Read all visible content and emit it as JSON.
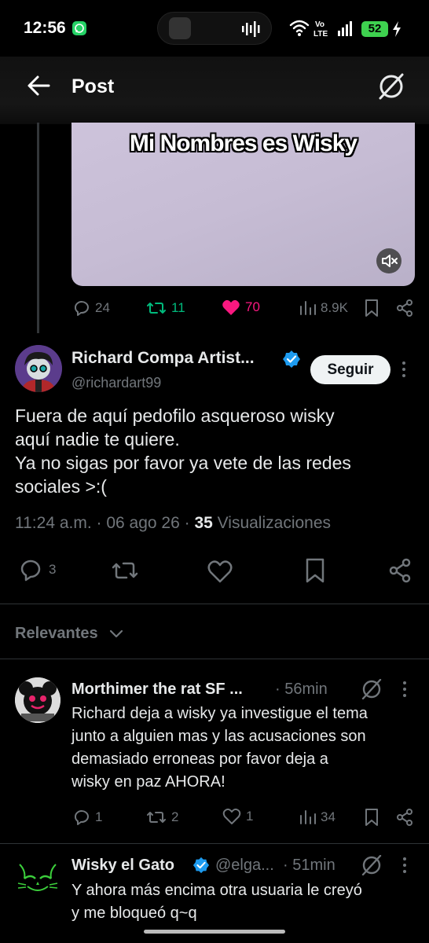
{
  "status_bar": {
    "time": "12:56",
    "network": "Vo LTE",
    "battery": "52"
  },
  "header": {
    "title": "Post"
  },
  "media": {
    "caption": "Mi Nombres es Wisky"
  },
  "parent_actions": {
    "replies": "24",
    "reposts": "11",
    "likes": "70",
    "views": "8.9K"
  },
  "post": {
    "author": "Richard Compa Artist...",
    "handle": "@richardart99",
    "follow_label": "Seguir",
    "text": "Fuera de aquí pedofilo asqueroso wisky\naquí nadie te quiere.\nYa no sigas por favor ya vete de las redes\nsociales >:(",
    "time": "11:24 a.m.",
    "date": "06 ago 26",
    "views_count": "35",
    "views_label": "Visualizaciones",
    "replies": "3"
  },
  "relevantes_label": "Relevantes",
  "replies": [
    {
      "author": "Morthimer the rat SF ...",
      "age": "56min",
      "text": "Richard deja a wisky ya investigue el tema\njunto a alguien mas y las acusaciones son\ndemasiado erroneas por favor deja a\nwisky en paz AHORA!",
      "replies": "1",
      "reposts": "2",
      "likes": "1",
      "views": "34"
    },
    {
      "author": "Wisky el Gato",
      "handle": "@elga...",
      "age": "51min",
      "text": "Y ahora más encima otra usuaria le creyó\ny me bloqueó q~q"
    }
  ],
  "colors": {
    "accent": "#1d9bf0",
    "repost_active": "#00ba7c",
    "like_active": "#f91880",
    "muted": "#71767b"
  }
}
